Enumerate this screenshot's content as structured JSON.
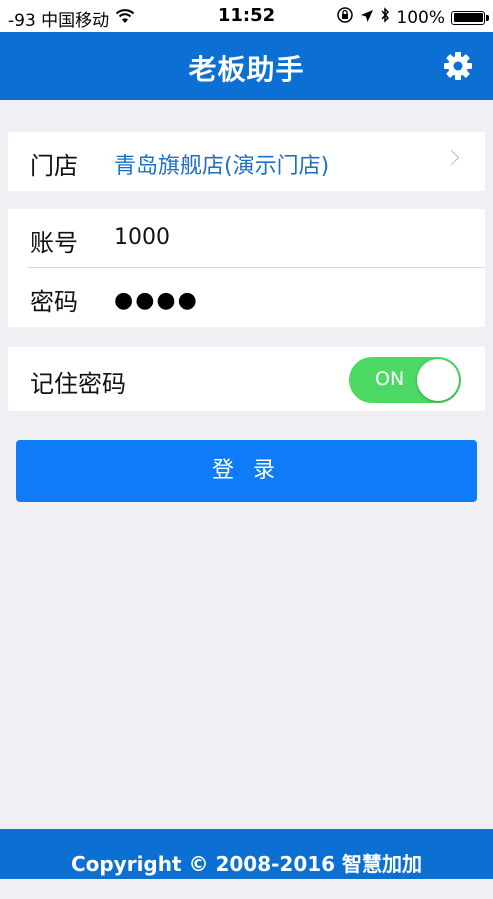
{
  "status_bar": {
    "carrier": "-93 中国移动",
    "time": "11:52",
    "battery": "100%"
  },
  "nav": {
    "title": "老板助手",
    "settings_icon": "gear-icon"
  },
  "store": {
    "label": "门店",
    "value": "青岛旗舰店(演示门店)"
  },
  "account": {
    "label": "账号",
    "value": "1000"
  },
  "password": {
    "label": "密码",
    "value": "●●●●"
  },
  "remember": {
    "label": "记住密码",
    "toggle_text": "ON",
    "checked": true
  },
  "login_button": "登 录",
  "footer": "Copyright © 2008-2016 智慧加加",
  "colors": {
    "brand": "#0c6fd3",
    "button": "#0f7bf6",
    "toggle_on": "#4cd964",
    "link": "#1d6fc7",
    "background": "#efeff4"
  }
}
